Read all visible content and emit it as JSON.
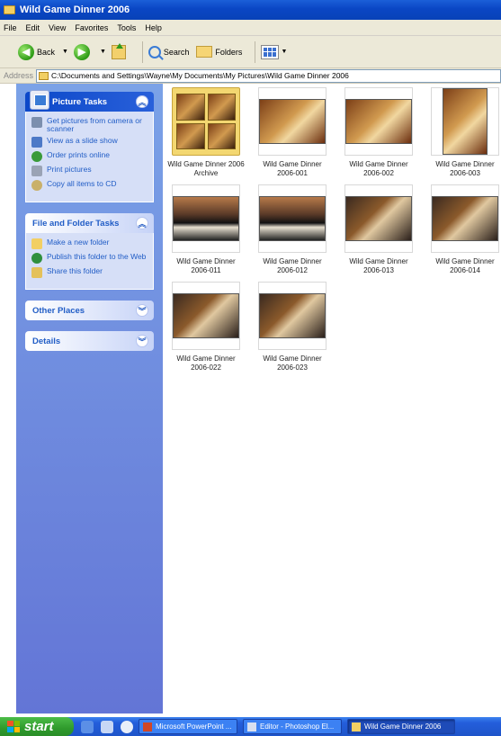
{
  "window": {
    "title": "Wild Game Dinner 2006"
  },
  "menu": [
    "File",
    "Edit",
    "View",
    "Favorites",
    "Tools",
    "Help"
  ],
  "toolbar": {
    "back_label": "Back",
    "search_label": "Search",
    "folders_label": "Folders"
  },
  "address": {
    "label": "Address",
    "path": "C:\\Documents and Settings\\Wayne\\My Documents\\My Pictures\\Wild Game Dinner 2006"
  },
  "sidebar": {
    "picture_tasks": {
      "title": "Picture Tasks",
      "items": [
        "Get pictures from camera or scanner",
        "View as a slide show",
        "Order prints online",
        "Print pictures",
        "Copy all items to CD"
      ]
    },
    "file_folder_tasks": {
      "title": "File and Folder Tasks",
      "items": [
        "Make a new folder",
        "Publish this folder to the Web",
        "Share this folder"
      ]
    },
    "other_places": {
      "title": "Other Places"
    },
    "details": {
      "title": "Details"
    }
  },
  "files": [
    {
      "line1": "Wild Game Dinner 2006",
      "line2": "Archive",
      "kind": "folder",
      "selected": true
    },
    {
      "line1": "Wild Game Dinner",
      "line2": "2006-001",
      "kind": "photo"
    },
    {
      "line1": "Wild Game Dinner",
      "line2": "2006-002",
      "kind": "photo"
    },
    {
      "line1": "Wild Game Dinner",
      "line2": "2006-003",
      "kind": "photo"
    },
    {
      "line1": "Wild Game Dinner",
      "line2": "2006-011",
      "kind": "photo"
    },
    {
      "line1": "Wild Game Dinner",
      "line2": "2006-012",
      "kind": "photo"
    },
    {
      "line1": "Wild Game Dinner",
      "line2": "2006-013",
      "kind": "photo"
    },
    {
      "line1": "Wild Game Dinner",
      "line2": "2006-014",
      "kind": "photo"
    },
    {
      "line1": "Wild Game Dinner",
      "line2": "2006-022",
      "kind": "photo"
    },
    {
      "line1": "Wild Game Dinner",
      "line2": "2006-023",
      "kind": "photo"
    }
  ],
  "taskbar": {
    "start_label": "start",
    "tasks": [
      "Microsoft PowerPoint ...",
      "Editor - Photoshop El...",
      "Wild Game Dinner 2006"
    ]
  },
  "colors": {
    "title_bar": "#0a46c4",
    "sidebar": "#6f8ce0",
    "taskbar": "#245edb",
    "start": "#2f9a2c",
    "link": "#215dc6"
  }
}
